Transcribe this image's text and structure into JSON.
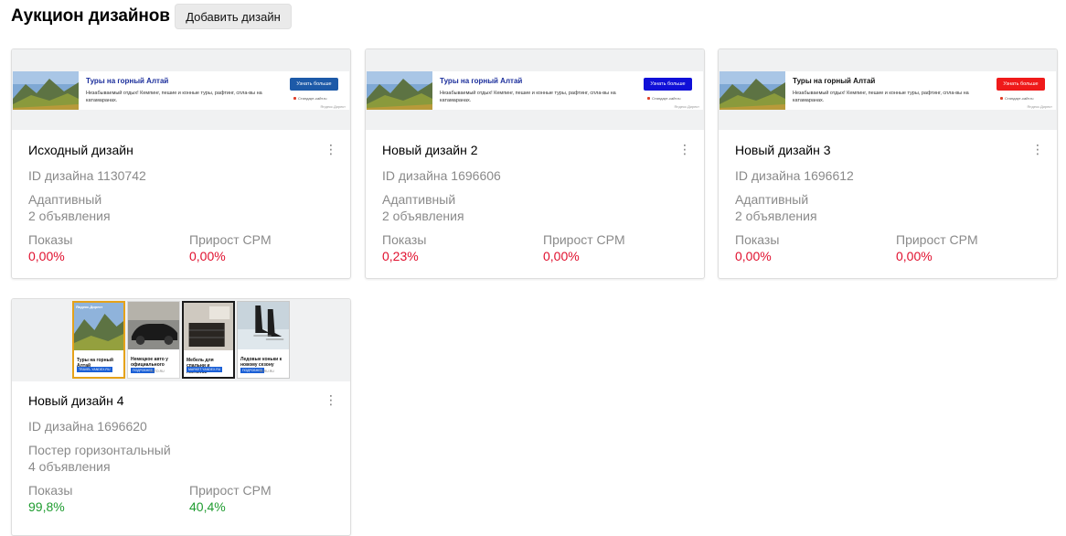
{
  "page": {
    "title": "Аукцион дизайнов",
    "add_button": "Добавить дизайн"
  },
  "banner": {
    "title": "Туры на горный Алтай",
    "description": "Незабываемый отдых! Кемпинг, пешие и конные туры, рафтинг, спла-вы на катамаранах.",
    "button": "Узнать больше",
    "site": "Стандарт-сайт.ru",
    "source": "Яндекс.Директ",
    "button_colors": [
      "#1d5aa8",
      "#1010d8",
      "#ef1a1a"
    ]
  },
  "cards": [
    {
      "title": "Исходный дизайн",
      "id_label": "ID дизайна 1130742",
      "format": "Адаптивный",
      "ads": "2 объявления",
      "shows_label": "Показы",
      "shows_value": "0,00%",
      "cpm_label": "Прирост CPM",
      "cpm_value": "0,00%"
    },
    {
      "title": "Новый дизайн 2",
      "id_label": "ID дизайна 1696606",
      "format": "Адаптивный",
      "ads": "2 объявления",
      "shows_label": "Показы",
      "shows_value": "0,23%",
      "cpm_label": "Прирост CPM",
      "cpm_value": "0,00%"
    },
    {
      "title": "Новый дизайн 3",
      "id_label": "ID дизайна 1696612",
      "format": "Адаптивный",
      "ads": "2 объявления",
      "shows_label": "Показы",
      "shows_value": "0,00%",
      "cpm_label": "Прирост CPM",
      "cpm_value": "0,00%"
    },
    {
      "title": "Новый дизайн 4",
      "id_label": "ID дизайна 1696620",
      "format": "Постер горизонтальный",
      "ads": "4 объявления",
      "shows_label": "Показы",
      "shows_value": "99,8%",
      "cpm_label": "Прирост CPM",
      "cpm_value": "40,4%"
    }
  ],
  "posters": [
    {
      "text": "Туры на горный Алтай",
      "button": "TRAVEL.YANDEX.RU",
      "url": "",
      "border": "#e5a21a"
    },
    {
      "text": "Немецкое авто у официального дилера",
      "button": "ПОДРОБНЕЕ",
      "url": "AUTO.RU",
      "border": "#d8d8d8"
    },
    {
      "text": "Мебель для спальни и гостиной",
      "button": "MARKET.YANDEX.RU",
      "url": "",
      "border": "#1b1b1b"
    },
    {
      "text": "Ледовые коньки к новому сезону",
      "button": "ПОДРОБНЕЕ",
      "url": "BERU.RU",
      "border": "#c9c9c9"
    }
  ],
  "poster_corner": "Яндекс.Директ",
  "colors": {
    "negative": "#e0102e",
    "positive": "#1f9c30",
    "title_blue": "#1c2f9c"
  }
}
